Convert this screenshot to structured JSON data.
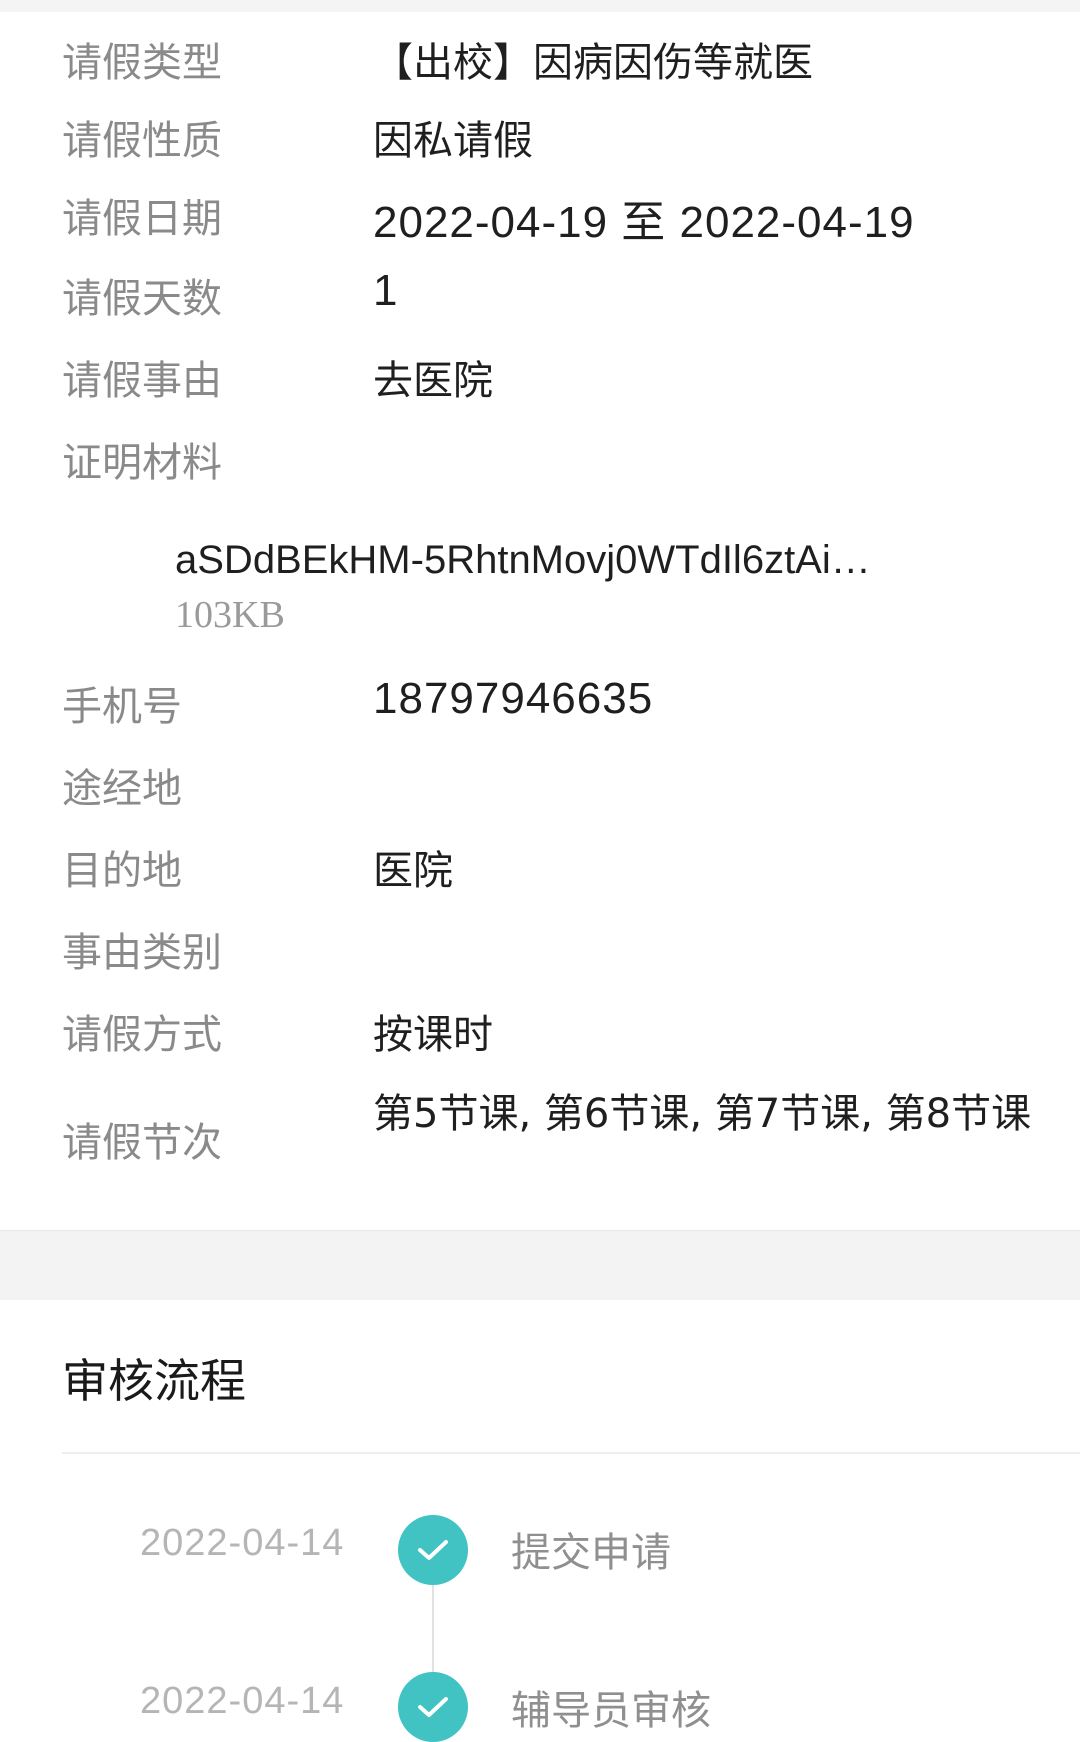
{
  "details": {
    "leave_type": {
      "label": "请假类型",
      "value": "【出校】因病因伤等就医"
    },
    "leave_nature": {
      "label": "请假性质",
      "value": "因私请假"
    },
    "leave_date": {
      "label": "请假日期",
      "value": "2022-04-19 至 2022-04-19"
    },
    "leave_days": {
      "label": "请假天数",
      "value": "1"
    },
    "leave_reason": {
      "label": "请假事由",
      "value": "去医院"
    },
    "proof": {
      "label": "证明材料",
      "file_name": "aSDdBEkHM-5RhtnMovj0WTdIl6ztAi…",
      "file_size": "103KB"
    },
    "phone": {
      "label": "手机号",
      "value": "18797946635"
    },
    "via": {
      "label": "途经地",
      "value": ""
    },
    "destination": {
      "label": "目的地",
      "value": "医院"
    },
    "reason_category": {
      "label": "事由类别",
      "value": ""
    },
    "leave_mode": {
      "label": "请假方式",
      "value": "按课时"
    },
    "leave_periods": {
      "label": "请假节次",
      "value": "第5节课, 第6节课, 第7节课, 第8节课"
    }
  },
  "approval": {
    "title": "审核流程",
    "steps": [
      {
        "date": "2022-04-14",
        "name": "提交申请",
        "status_icon": "check-icon"
      },
      {
        "date": "2022-04-14",
        "name": "辅导员审核",
        "status_icon": "check-icon"
      }
    ],
    "accent_color": "#41c2c3"
  }
}
